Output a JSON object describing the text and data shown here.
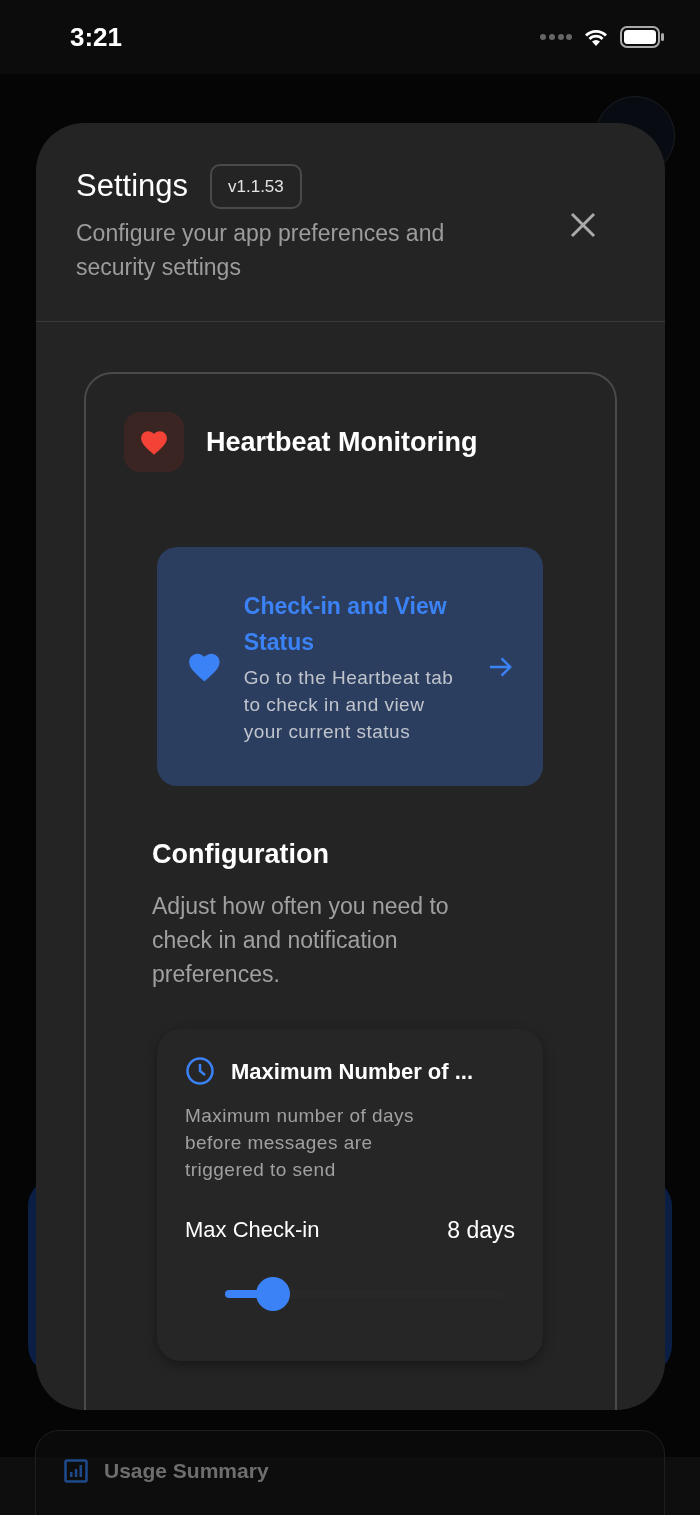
{
  "status_bar": {
    "time": "3:21"
  },
  "app": {
    "usage_summary": "Usage Summary"
  },
  "settings": {
    "title": "Settings",
    "version": "v1.1.53",
    "subtitle": "Configure your app preferences and security settings",
    "section": {
      "title": "Heartbeat Monitoring",
      "link_card": {
        "title": "Check-in and View Status",
        "description": "Go to the Heartbeat tab to check in and view your current status"
      },
      "configuration": {
        "title": "Configuration",
        "description": "Adjust how often you need to check in and notification preferences."
      },
      "setting": {
        "title": "Maximum Number of ...",
        "description": "Maximum number of days before messages are triggered to send",
        "label": "Max Check-in",
        "value": "8 days",
        "level": 0.17
      }
    }
  }
}
